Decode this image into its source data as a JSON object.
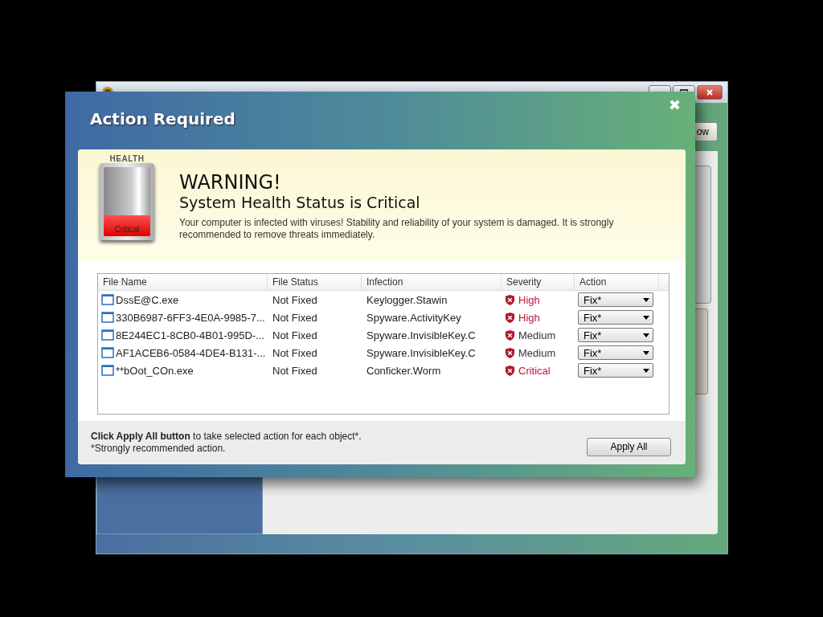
{
  "back_window": {
    "side_button": "ow"
  },
  "dialog": {
    "title": "Action Required",
    "close": "✖",
    "health": {
      "label": "HEALTH",
      "status": "Critical",
      "level": 0.3
    },
    "warning": {
      "heading": "WARNING!",
      "subheading": "System Health Status is Critical",
      "message": "Your computer is infected with viruses! Stability and reliability of your system is damaged. It is strongly recommended to remove threats immediately."
    },
    "table": {
      "columns": [
        "File Name",
        "File Status",
        "Infection",
        "Severity",
        "Action"
      ],
      "rows": [
        {
          "file": "DssE@C.exe",
          "status": "Not Fixed",
          "infection": "Keylogger.Stawin",
          "severity": "High",
          "color": "#c0143c",
          "action": "Fix*"
        },
        {
          "file": "330B6987-6FF3-4E0A-9985-7...",
          "status": "Not Fixed",
          "infection": "Spyware.ActivityKey",
          "severity": "High",
          "color": "#c0143c",
          "action": "Fix*"
        },
        {
          "file": "8E244EC1-8CB0-4B01-995D-...",
          "status": "Not Fixed",
          "infection": "Spyware.InvisibleKey.C",
          "severity": "Medium",
          "color": "#333333",
          "action": "Fix*"
        },
        {
          "file": "AF1ACEB6-0584-4DE4-B131-...",
          "status": "Not Fixed",
          "infection": "Spyware.InvisibleKey.C",
          "severity": "Medium",
          "color": "#333333",
          "action": "Fix*"
        },
        {
          "file": "**bOot_COn.exe",
          "status": "Not Fixed",
          "infection": "Conficker.Worm",
          "severity": "Critical",
          "color": "#c0143c",
          "action": "Fix*"
        }
      ]
    },
    "footer": {
      "instruction": "**Click Apply All button** to take selected action for each object*.",
      "note": "*Strongly recommended action.",
      "button": "Apply All"
    }
  }
}
